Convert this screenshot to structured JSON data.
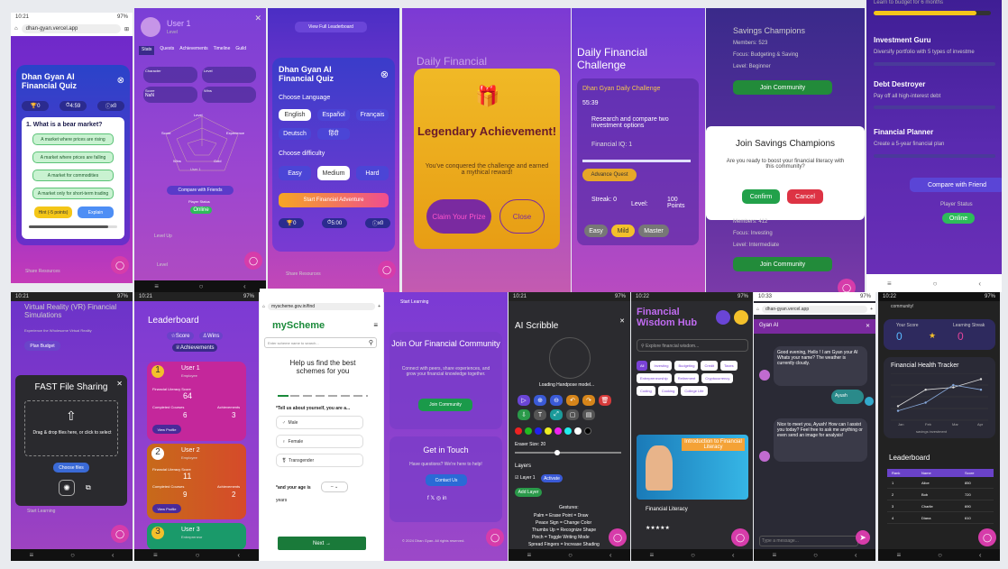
{
  "p1": {
    "status_time": "10:21",
    "status_right": "97%",
    "url": "dhan-gyan.vercel.app",
    "title": "Dhan Gyan AI Financial Quiz",
    "stat1": "0",
    "stat2": "4:59",
    "stat3": "x0",
    "question": "1. What is a bear market?",
    "options": [
      "A market where prices are rising",
      "A market where prices are falling",
      "A market for commodities",
      "A market only for short-term trading"
    ],
    "hint": "Hint (-5 points)",
    "explain": "Explain",
    "bg_link": "Share Resources"
  },
  "p2": {
    "user": "User 1",
    "level": "Level",
    "tabs": [
      "Stats",
      "Quests",
      "Achievements",
      "Timeline",
      "Guild"
    ],
    "stat_labels": [
      "Character",
      "Level",
      "Score",
      "Wins"
    ],
    "stat_values": [
      "",
      "",
      "NaN",
      ""
    ],
    "radar": [
      "Level",
      "Experience",
      "Gold",
      "Wins",
      "Score"
    ],
    "radar_user": "User 1",
    "compare": "Compare with Friends",
    "player_status": "Player Status",
    "online": "Online",
    "bg": [
      "Level Up",
      "Level"
    ]
  },
  "p3": {
    "top": "View Full Leaderboard",
    "title": "Dhan Gyan AI Financial Quiz",
    "lang_label": "Choose Language",
    "langs": [
      "English",
      "Español",
      "Français",
      "Deutsch",
      "हिंदी"
    ],
    "diff_label": "Choose difficulty",
    "diffs": [
      "Easy",
      "Medium",
      "Hard"
    ],
    "start": "Start Financial Adventure",
    "s1": "0",
    "s2": "5:00",
    "s3": "x0",
    "bg": "Share Resources"
  },
  "p4": {
    "bg_title": "Daily Financial",
    "title": "Legendary Achievement!",
    "text": "You've conquered the challenge and earned a mythical reward!",
    "claim": "Claim Your Prize",
    "close": "Close"
  },
  "p5": {
    "title": "Daily Financial Challenge",
    "sub": "Dhan Gyan Daily Challenge",
    "timer": "55:39",
    "task": "Research and compare two investment options",
    "iq": "Financial IQ: 1",
    "advance": "Advance Quest",
    "streak": "Streak: 0",
    "level": "Level:",
    "points": "100 Points",
    "modes": [
      "Easy",
      "Mild",
      "Master"
    ]
  },
  "p6": {
    "title": "Savings Champions",
    "members": "Members: 523",
    "focus": "Focus: Budgeting & Saving",
    "level": "Level: Beginner",
    "join": "Join Community",
    "modal_title": "Join Savings Champions",
    "modal_text": "Are you ready to boost your financial literacy with this community?",
    "confirm": "Confirm",
    "cancel": "Cancel",
    "members2": "Members: 412",
    "focus2": "Focus: Investing",
    "level2": "Level: Intermediate",
    "join2": "Join Community"
  },
  "p7": {
    "top": "Learn to budget for 6 months",
    "g1_t": "Investment Guru",
    "g1_d": "Diversify portfolio with 5 types of investme",
    "g2_t": "Debt Destroyer",
    "g2_d": "Pay off all high-interest debt",
    "g3_t": "Financial Planner",
    "g3_d": "Create a 5-year financial plan",
    "compare": "Compare with Friend",
    "player_status": "Player Status",
    "online": "Online"
  },
  "p8": {
    "bg_title": "Virtual Reality (VR) Financial Simulations",
    "bg_sub": "Experience the Wholesome Virtual Reality",
    "plan": "Plan Budget",
    "title": "FAST File Sharing",
    "drop": "Drag & drop files here, or click to select",
    "choose": "Choose files",
    "bg_link": "Start Learning"
  },
  "p9": {
    "title": "Leaderboard",
    "tab1": "Score",
    "tab2": "Wins",
    "tab3": "Achievements",
    "users": [
      {
        "rank": "1",
        "name": "User 1",
        "role": "Employee",
        "score": "64",
        "courses": "6",
        "ach": "3"
      },
      {
        "rank": "2",
        "name": "User 2",
        "role": "Employee",
        "score": "11",
        "courses": "9",
        "ach": "2"
      },
      {
        "rank": "3",
        "name": "User 3",
        "role": "Entrepreneur"
      }
    ],
    "lbl_score": "Financial Literacy Score",
    "lbl_courses": "Completed Courses",
    "lbl_ach": "Achievements",
    "view": "View Profile"
  },
  "p10": {
    "url": "myscheme.gov.in/find",
    "logo": "myScheme",
    "search": "Enter scheme name to search...",
    "heading": "Help us find the best schemes for you",
    "q1": "*Tell us about yourself, you are a...",
    "g": [
      "Male",
      "Female",
      "Transgender"
    ],
    "q2": "*and your age is",
    "years": "years",
    "next": "Next →"
  },
  "p11": {
    "top": "Start Learning",
    "title": "Join Our Financial Community",
    "text": "Connect with peers, share experiences, and grow your financial knowledge together.",
    "join": "Join Community",
    "t2": "Get in Touch",
    "t2_text": "Have questions? We're here to help!",
    "contact": "Contact Us",
    "footer": "© 2024 Dhan Gyan. All rights reserved."
  },
  "p12": {
    "title": "AI Scribble",
    "loading": "Loading Handpose model...",
    "eraser": "Eraser Size: 20",
    "layers": "Layers",
    "layer1": "Layer 1",
    "activate": "Activate",
    "add": "Add Layer",
    "gestures_t": "Gestures:",
    "gestures": [
      "Palm = Erase  Point = Draw",
      "Peace Sign = Change Color",
      "Thumbs Up = Recognize Shape",
      "Pinch = Toggle Writing Mode",
      "Spread Fingers = Increase Shading"
    ]
  },
  "p13": {
    "title": "Financial Wisdom Hub",
    "search": "Explore financial wisdom...",
    "tags": [
      "All",
      "Investing",
      "Budgeting",
      "Credit",
      "Taxes",
      "Entrepreneurship",
      "Retirement",
      "Cryptocurrency",
      "Coding",
      "Cooking",
      "College Life"
    ],
    "video": "Introduction to Financial Literacy",
    "card": "Financial Literacy",
    "stars": "★★★★★"
  },
  "p14": {
    "url": "dhan-gyan.vercel.app",
    "bot": "Gyan AI",
    "m1": "Good evening, Hello ! I am Gyan your AI Whats your name? The weather is currently cloudy.",
    "m2": "Ayush",
    "m3": "Nice to meet you, Ayush! How can I assist you today? Feel free to ask me anything or even send an image for analysis!",
    "input": "Type a message..."
  },
  "p15": {
    "top": "community!",
    "your_score": "Your Score",
    "lstreak": "Learning Streak",
    "score": "0",
    "streak": "0",
    "tracker": "Financial Health Tracker",
    "months": [
      "Jan",
      "Feb",
      "Mar",
      "Apr"
    ],
    "legend": "savings  investment",
    "lb": "Leaderboard",
    "cols": [
      "Rank",
      "Name",
      "Score"
    ],
    "rows": [
      [
        "1",
        "Alice",
        "850"
      ],
      [
        "2",
        "Bob",
        "720"
      ],
      [
        "3",
        "Charlie",
        "690"
      ],
      [
        "4",
        "Diana",
        "610"
      ]
    ]
  },
  "chart_data": {
    "type": "line",
    "categories": [
      "Jan",
      "Feb",
      "Mar",
      "Apr"
    ],
    "series": [
      {
        "name": "savings",
        "values": [
          120,
          260,
          280,
          350
        ]
      },
      {
        "name": "investment",
        "values": [
          80,
          150,
          300,
          260
        ]
      }
    ]
  }
}
